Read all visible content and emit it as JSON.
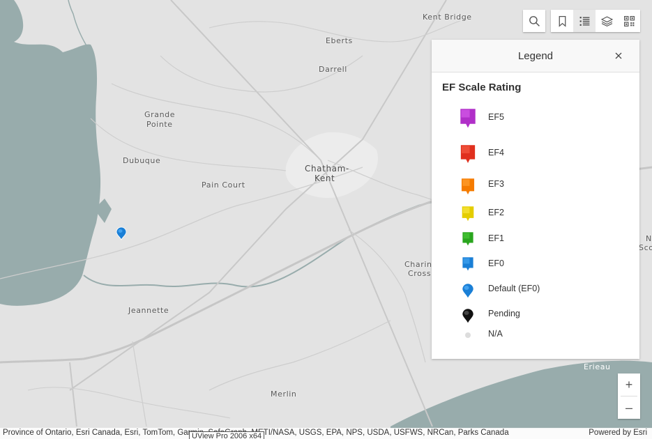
{
  "map": {
    "places": [
      {
        "id": "kent-bridge",
        "text": "Kent Bridge"
      },
      {
        "id": "eberts",
        "text": "Eberts"
      },
      {
        "id": "darrell",
        "text": "Darrell"
      },
      {
        "id": "grande-pointe-1",
        "text": "Grande"
      },
      {
        "id": "grande-pointe-2",
        "text": "Pointe"
      },
      {
        "id": "dubuque",
        "text": "Dubuque"
      },
      {
        "id": "chatham-1",
        "text": "Chatham-"
      },
      {
        "id": "chatham-2",
        "text": "Kent"
      },
      {
        "id": "pain-court",
        "text": "Pain Court"
      },
      {
        "id": "charing-1",
        "text": "Charing"
      },
      {
        "id": "charing-2",
        "text": "Cross"
      },
      {
        "id": "jeannette",
        "text": "Jeannette"
      },
      {
        "id": "merlin",
        "text": "Merlin"
      },
      {
        "id": "erieau",
        "text": "Erieau"
      },
      {
        "id": "edge-n",
        "text": "N"
      },
      {
        "id": "edge-sco",
        "text": "Sco"
      }
    ]
  },
  "toolbar": {
    "search_icon": "search-icon",
    "bookmark_icon": "bookmark-icon",
    "legend_icon": "list-icon",
    "layers_icon": "layers-icon",
    "qr_icon": "qr-code-icon"
  },
  "legend": {
    "title": "Legend",
    "layer_title": "EF Scale Rating",
    "items": [
      {
        "label": "EF5",
        "color": "#b02fc8",
        "highlight": "#d45ae8"
      },
      {
        "label": "EF4",
        "color": "#e0301e",
        "highlight": "#f45a42"
      },
      {
        "label": "EF3",
        "color": "#f57b00",
        "highlight": "#ffa030"
      },
      {
        "label": "EF2",
        "color": "#e4cd00",
        "highlight": "#f8e640"
      },
      {
        "label": "EF1",
        "color": "#2aa51e",
        "highlight": "#48c838"
      },
      {
        "label": "EF0",
        "color": "#1a7fd6",
        "highlight": "#42a2f0"
      },
      {
        "label": "Default (EF0)",
        "color": "#1a7fd6",
        "highlight": "#42a2f0"
      },
      {
        "label": "Pending",
        "color": "#111111",
        "highlight": "#444444"
      },
      {
        "label": "N/A",
        "color": "#dddddd",
        "highlight": "#eeeeee"
      }
    ]
  },
  "zoom": {
    "in_label": "+",
    "out_label": "–"
  },
  "attribution": {
    "text": "Province of Ontario, Esri Canada, Esri, TomTom, Garmin, SafeGraph, METI/NASA, USGS, EPA, NPS, USDA, USFWS, NRCan, Parks Canada",
    "powered": "Powered by Esri",
    "tooltip": "UView Pro 2006 x64"
  },
  "colors": {
    "water": "#98acac",
    "land": "#e3e3e3",
    "road": "#c6c6c6",
    "urban": "#eeeeee"
  }
}
